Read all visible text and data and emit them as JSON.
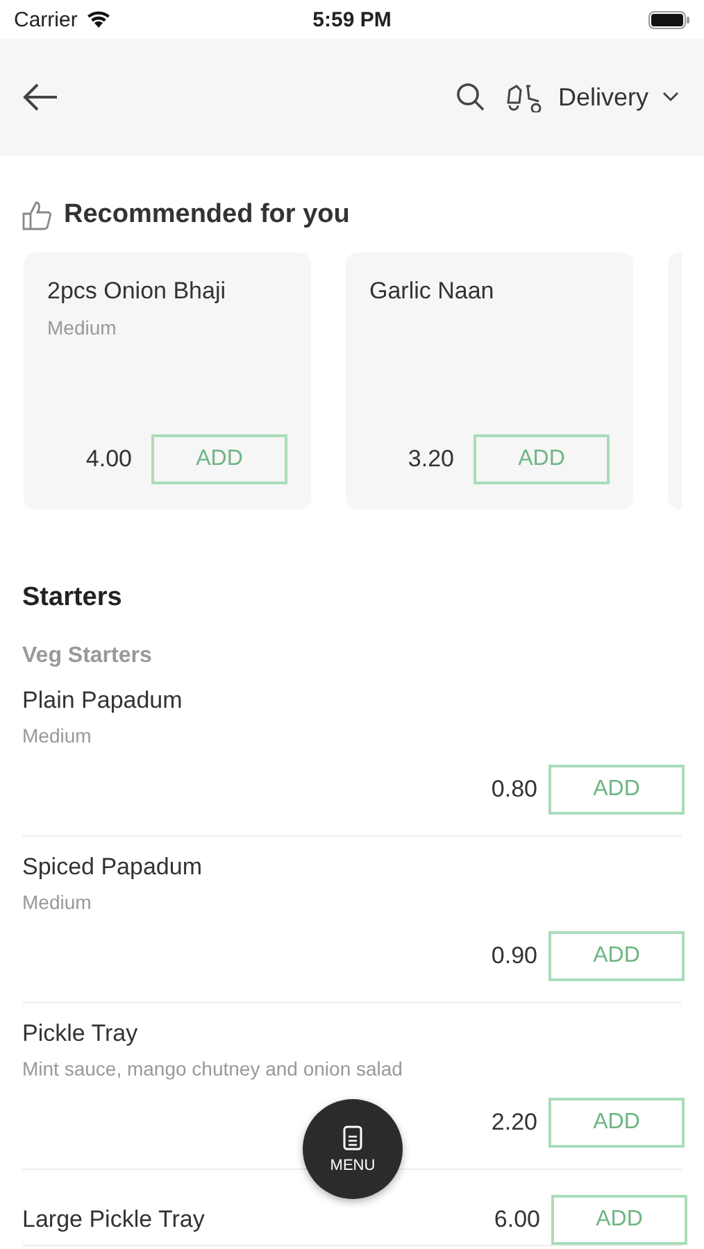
{
  "status_bar": {
    "carrier": "Carrier",
    "time": "5:59 PM"
  },
  "header": {
    "mode": "Delivery"
  },
  "recommended": {
    "title": "Recommended for you",
    "items": [
      {
        "name": "2pcs Onion Bhaji",
        "desc": "Medium",
        "price": "4.00",
        "button": "ADD"
      },
      {
        "name": "Garlic Naan",
        "price": "3.20",
        "button": "ADD"
      }
    ]
  },
  "section": {
    "title": "Starters",
    "subtitle": "Veg Starters",
    "items": [
      {
        "kind": "stacked",
        "name": "Plain Papadum",
        "desc": "Medium",
        "price": "0.80",
        "button": "ADD"
      },
      {
        "kind": "stacked",
        "name": "Spiced Papadum",
        "desc": "Medium",
        "price": "0.90",
        "button": "ADD"
      },
      {
        "kind": "stacked",
        "name": "Pickle Tray",
        "desc": "Mint sauce, mango chutney and onion salad",
        "price": "2.20",
        "button": "ADD"
      },
      {
        "kind": "inline",
        "name": "Large Pickle Tray",
        "price": "6.00",
        "button": "ADD"
      }
    ]
  },
  "fab": {
    "label": "MENU"
  }
}
